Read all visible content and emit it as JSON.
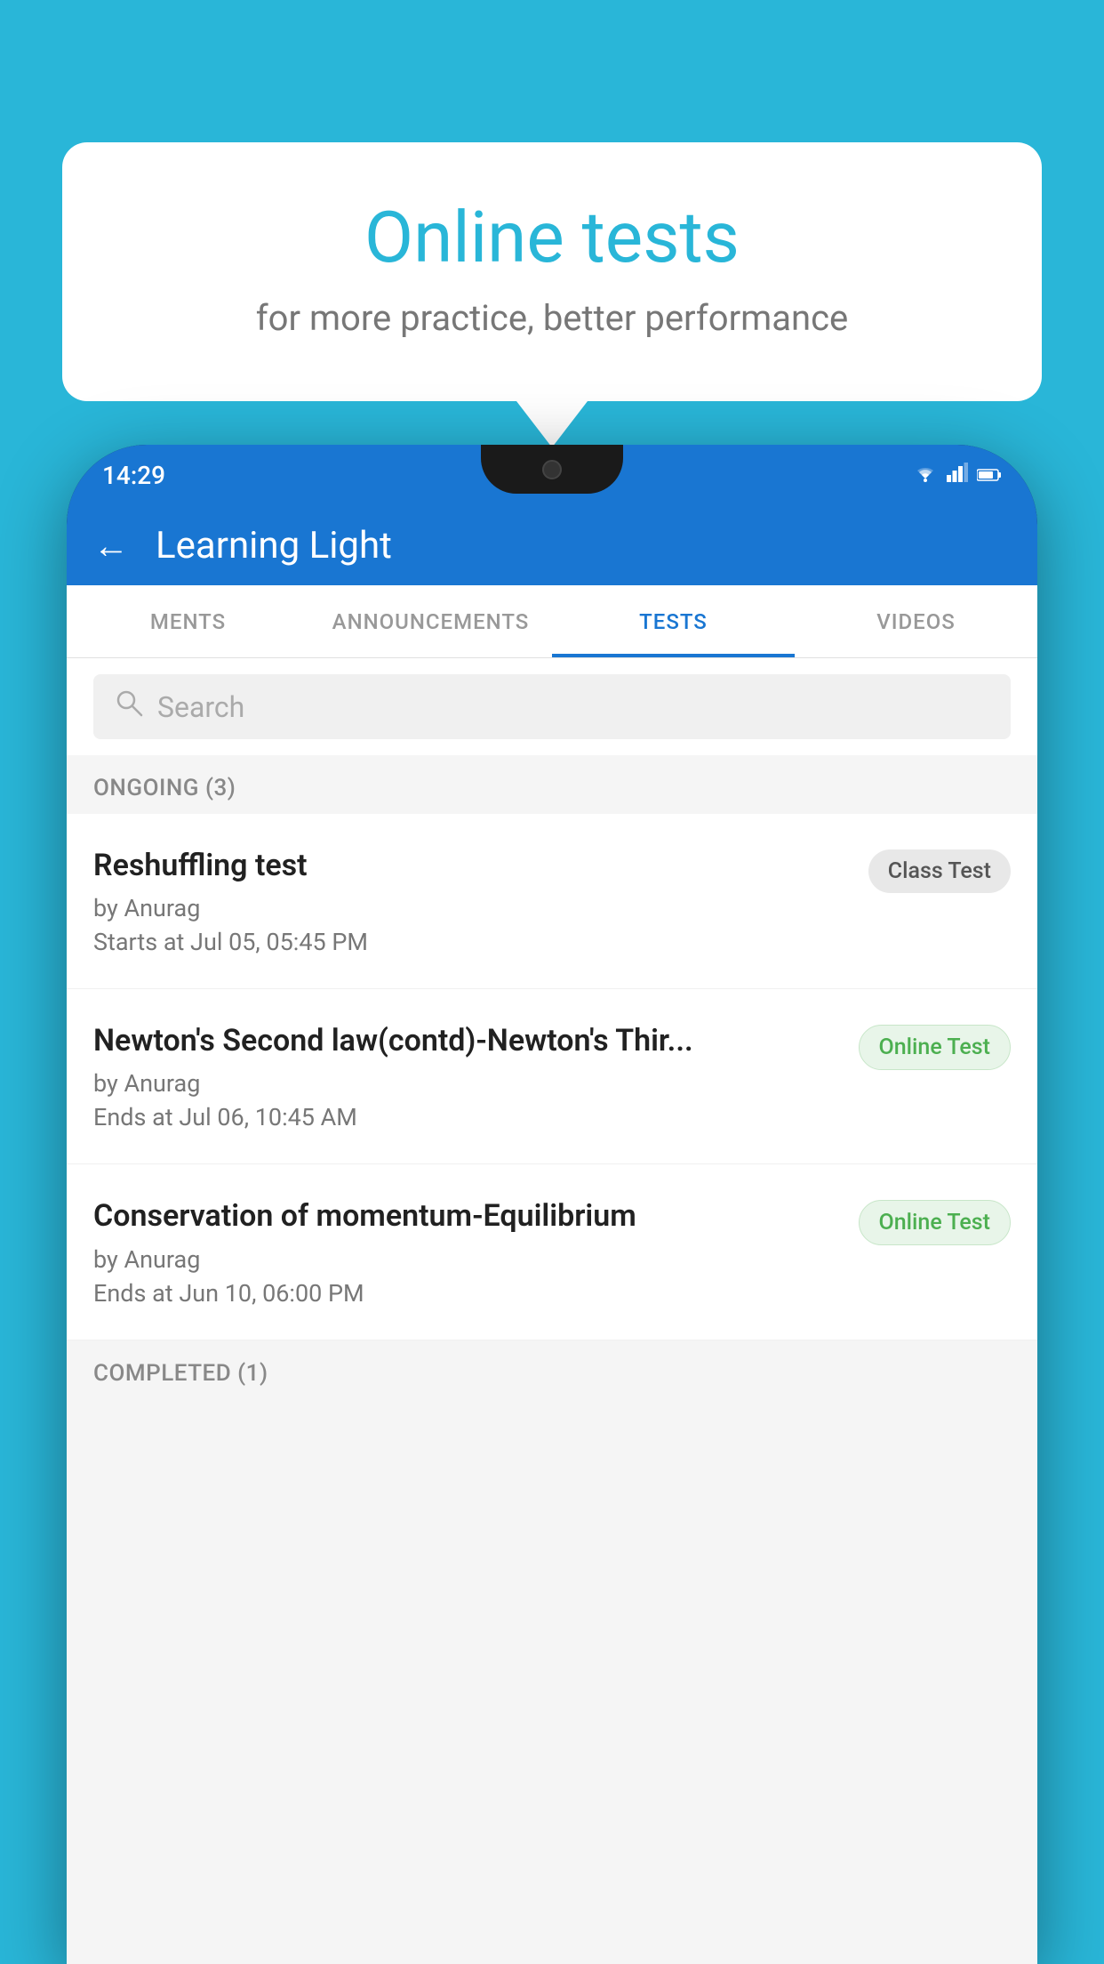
{
  "background_color": "#29b6d8",
  "speech_bubble": {
    "title": "Online tests",
    "subtitle": "for more practice, better performance"
  },
  "phone": {
    "status_bar": {
      "time": "14:29",
      "icons": [
        "wifi",
        "signal",
        "battery"
      ]
    },
    "app_header": {
      "title": "Learning Light",
      "back_label": "←"
    },
    "tabs": [
      {
        "label": "MENTS",
        "active": false
      },
      {
        "label": "ANNOUNCEMENTS",
        "active": false
      },
      {
        "label": "TESTS",
        "active": true
      },
      {
        "label": "VIDEOS",
        "active": false
      }
    ],
    "search": {
      "placeholder": "Search"
    },
    "ongoing_section": {
      "header": "ONGOING (3)",
      "items": [
        {
          "name": "Reshuffling test",
          "by": "by Anurag",
          "time": "Starts at  Jul 05, 05:45 PM",
          "badge": "Class Test",
          "badge_type": "class"
        },
        {
          "name": "Newton's Second law(contd)-Newton's Thir...",
          "by": "by Anurag",
          "time": "Ends at  Jul 06, 10:45 AM",
          "badge": "Online Test",
          "badge_type": "online"
        },
        {
          "name": "Conservation of momentum-Equilibrium",
          "by": "by Anurag",
          "time": "Ends at  Jun 10, 06:00 PM",
          "badge": "Online Test",
          "badge_type": "online"
        }
      ]
    },
    "completed_section": {
      "header": "COMPLETED (1)"
    }
  }
}
